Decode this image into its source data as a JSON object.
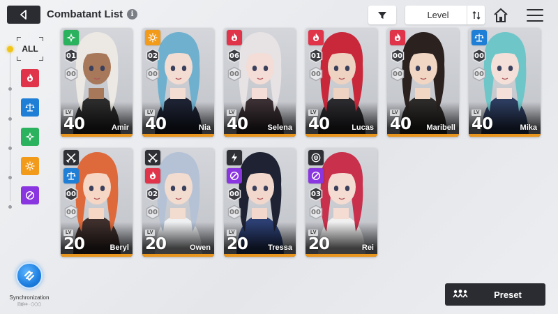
{
  "header": {
    "title": "Combatant List",
    "sort_label": "Level"
  },
  "sidebar": {
    "all_label": "ALL",
    "filters": [
      {
        "name": "fire",
        "color": "#e0344a"
      },
      {
        "name": "balance",
        "color": "#1f7fd6"
      },
      {
        "name": "wind",
        "color": "#2bb25e"
      },
      {
        "name": "sun",
        "color": "#f29a1a"
      },
      {
        "name": "void",
        "color": "#8a36e0"
      }
    ]
  },
  "combatants": [
    {
      "name": "Amir",
      "level": "40",
      "lv_tag": "LV",
      "class_icon": null,
      "element": "wind",
      "element_color": "#2bb25e",
      "rank": "01",
      "sub": "00",
      "hair": "#ece8e3",
      "skin": "#a7785a",
      "outfit": "#2b2b2b"
    },
    {
      "name": "Nia",
      "level": "40",
      "lv_tag": "LV",
      "class_icon": null,
      "element": "sun",
      "element_color": "#f29a1a",
      "rank": "02",
      "sub": "00",
      "hair": "#6fb0cf",
      "skin": "#f3dcd2",
      "outfit": "#1d2233"
    },
    {
      "name": "Selena",
      "level": "40",
      "lv_tag": "LV",
      "class_icon": null,
      "element": "fire",
      "element_color": "#e0344a",
      "rank": "06",
      "sub": "00",
      "hair": "#e7e2e4",
      "skin": "#f3ddd6",
      "outfit": "#3a2f33"
    },
    {
      "name": "Lucas",
      "level": "40",
      "lv_tag": "LV",
      "class_icon": null,
      "element": "fire",
      "element_color": "#e0344a",
      "rank": "01",
      "sub": "00",
      "hair": "#c8283a",
      "skin": "#eed2c2",
      "outfit": "#2a2a2e"
    },
    {
      "name": "Maribell",
      "level": "40",
      "lv_tag": "LV",
      "class_icon": null,
      "element": "fire",
      "element_color": "#e0344a",
      "rank": "00",
      "sub": "00",
      "hair": "#2b2220",
      "skin": "#f1d6c4",
      "outfit": "#2c2a28"
    },
    {
      "name": "Mika",
      "level": "40",
      "lv_tag": "LV",
      "class_icon": null,
      "element": "balance",
      "element_color": "#1f7fd6",
      "rank": "00",
      "sub": "00",
      "hair": "#6fc6c9",
      "skin": "#f4e0d8",
      "outfit": "#2c3c5e"
    },
    {
      "name": "Beryl",
      "level": "20",
      "lv_tag": "LV",
      "class_icon": "crossed-swords",
      "element": "balance",
      "element_color": "#1f7fd6",
      "rank": "00",
      "sub": "00",
      "hair": "#de6a3c",
      "skin": "#f6d6c4",
      "outfit": "#3e2f2c"
    },
    {
      "name": "Owen",
      "level": "20",
      "lv_tag": "LV",
      "class_icon": "crossed-swords",
      "element": "fire",
      "element_color": "#e0344a",
      "rank": "02",
      "sub": "00",
      "hair": "#b5c2d6",
      "skin": "#f2dcd0",
      "outfit": "#eef0f2"
    },
    {
      "name": "Tressa",
      "level": "20",
      "lv_tag": "LV",
      "class_icon": "lightning",
      "element": "void",
      "element_color": "#8a36e0",
      "rank": "00",
      "sub": "00",
      "hair": "#1e2233",
      "skin": "#f2d8cc",
      "outfit": "#2c3f73"
    },
    {
      "name": "Rei",
      "level": "20",
      "lv_tag": "LV",
      "class_icon": "target",
      "element": "void",
      "element_color": "#8a36e0",
      "rank": "03",
      "sub": "00",
      "hair": "#c8304c",
      "skin": "#f5dcd2",
      "outfit": "#f0f0f0"
    }
  ],
  "footer": {
    "sync_label": "Synchronization",
    "sync_sub": "同期中 · 〇〇〇",
    "preset_label": "Preset"
  }
}
